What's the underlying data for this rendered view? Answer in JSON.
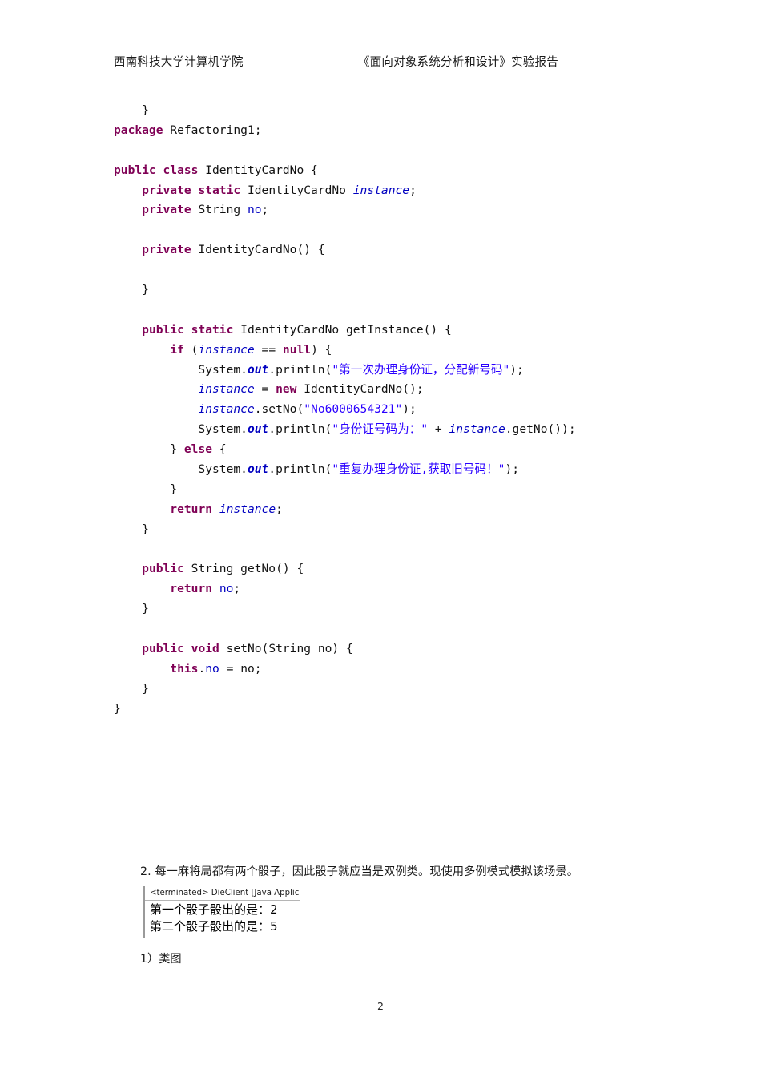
{
  "header": {
    "left": "西南科技大学计算机学院",
    "right": "《面向对象系统分析和设计》实验报告"
  },
  "code": {
    "language": "java",
    "lines": [
      [
        {
          "t": "    }",
          "c": "plain"
        }
      ],
      [
        {
          "t": "package",
          "c": "kw"
        },
        {
          "t": " Refactoring1;",
          "c": "plain"
        }
      ],
      [],
      [
        {
          "t": "public class",
          "c": "kw"
        },
        {
          "t": " IdentityCardNo {",
          "c": "plain"
        }
      ],
      [
        {
          "t": "    ",
          "c": "plain"
        },
        {
          "t": "private static",
          "c": "kw"
        },
        {
          "t": " IdentityCardNo ",
          "c": "plain"
        },
        {
          "t": "instance",
          "c": "fldi"
        },
        {
          "t": ";",
          "c": "plain"
        }
      ],
      [
        {
          "t": "    ",
          "c": "plain"
        },
        {
          "t": "private",
          "c": "kw"
        },
        {
          "t": " String ",
          "c": "plain"
        },
        {
          "t": "no",
          "c": "fld"
        },
        {
          "t": ";",
          "c": "plain"
        }
      ],
      [],
      [
        {
          "t": "    ",
          "c": "plain"
        },
        {
          "t": "private",
          "c": "kw"
        },
        {
          "t": " IdentityCardNo() {",
          "c": "plain"
        }
      ],
      [],
      [
        {
          "t": "    }",
          "c": "plain"
        }
      ],
      [],
      [
        {
          "t": "    ",
          "c": "plain"
        },
        {
          "t": "public static",
          "c": "kw"
        },
        {
          "t": " IdentityCardNo getInstance() {",
          "c": "plain"
        }
      ],
      [
        {
          "t": "        ",
          "c": "plain"
        },
        {
          "t": "if",
          "c": "kw"
        },
        {
          "t": " (",
          "c": "plain"
        },
        {
          "t": "instance",
          "c": "fldi"
        },
        {
          "t": " == ",
          "c": "plain"
        },
        {
          "t": "null",
          "c": "kw"
        },
        {
          "t": ") {",
          "c": "plain"
        }
      ],
      [
        {
          "t": "            System.",
          "c": "plain"
        },
        {
          "t": "out",
          "c": "stat"
        },
        {
          "t": ".println(",
          "c": "plain"
        },
        {
          "t": "\"第一次办理身份证，分配新号码\"",
          "c": "str"
        },
        {
          "t": ");",
          "c": "plain"
        }
      ],
      [
        {
          "t": "            ",
          "c": "plain"
        },
        {
          "t": "instance",
          "c": "fldi"
        },
        {
          "t": " = ",
          "c": "plain"
        },
        {
          "t": "new",
          "c": "kw"
        },
        {
          "t": " IdentityCardNo();",
          "c": "plain"
        }
      ],
      [
        {
          "t": "            ",
          "c": "plain"
        },
        {
          "t": "instance",
          "c": "fldi"
        },
        {
          "t": ".setNo(",
          "c": "plain"
        },
        {
          "t": "\"No6000654321\"",
          "c": "str"
        },
        {
          "t": ");",
          "c": "plain"
        }
      ],
      [
        {
          "t": "            System.",
          "c": "plain"
        },
        {
          "t": "out",
          "c": "stat"
        },
        {
          "t": ".println(",
          "c": "plain"
        },
        {
          "t": "\"身份证号码为：\"",
          "c": "str"
        },
        {
          "t": " + ",
          "c": "plain"
        },
        {
          "t": "instance",
          "c": "fldi"
        },
        {
          "t": ".getNo());",
          "c": "plain"
        }
      ],
      [
        {
          "t": "        } ",
          "c": "plain"
        },
        {
          "t": "else",
          "c": "kw"
        },
        {
          "t": " {",
          "c": "plain"
        }
      ],
      [
        {
          "t": "            System.",
          "c": "plain"
        },
        {
          "t": "out",
          "c": "stat"
        },
        {
          "t": ".println(",
          "c": "plain"
        },
        {
          "t": "\"重复办理身份证,获取旧号码！\"",
          "c": "str"
        },
        {
          "t": ");",
          "c": "plain"
        }
      ],
      [
        {
          "t": "        }",
          "c": "plain"
        }
      ],
      [
        {
          "t": "        ",
          "c": "plain"
        },
        {
          "t": "return",
          "c": "kw"
        },
        {
          "t": " ",
          "c": "plain"
        },
        {
          "t": "instance",
          "c": "fldi"
        },
        {
          "t": ";",
          "c": "plain"
        }
      ],
      [
        {
          "t": "    }",
          "c": "plain"
        }
      ],
      [],
      [
        {
          "t": "    ",
          "c": "plain"
        },
        {
          "t": "public",
          "c": "kw"
        },
        {
          "t": " String getNo() {",
          "c": "plain"
        }
      ],
      [
        {
          "t": "        ",
          "c": "plain"
        },
        {
          "t": "return",
          "c": "kw"
        },
        {
          "t": " ",
          "c": "plain"
        },
        {
          "t": "no",
          "c": "fld"
        },
        {
          "t": ";",
          "c": "plain"
        }
      ],
      [
        {
          "t": "    }",
          "c": "plain"
        }
      ],
      [],
      [
        {
          "t": "    ",
          "c": "plain"
        },
        {
          "t": "public void",
          "c": "kw"
        },
        {
          "t": " setNo(String ",
          "c": "plain"
        },
        {
          "t": "no",
          "c": "plain"
        },
        {
          "t": ") {",
          "c": "plain"
        }
      ],
      [
        {
          "t": "        ",
          "c": "plain"
        },
        {
          "t": "this",
          "c": "kw"
        },
        {
          "t": ".",
          "c": "plain"
        },
        {
          "t": "no",
          "c": "fld"
        },
        {
          "t": " = ",
          "c": "plain"
        },
        {
          "t": "no",
          "c": "plain"
        },
        {
          "t": ";",
          "c": "plain"
        }
      ],
      [
        {
          "t": "    }",
          "c": "plain"
        }
      ],
      [
        {
          "t": "}",
          "c": "plain"
        }
      ]
    ]
  },
  "body": {
    "question": "2. 每一麻将局都有两个骰子，因此骰子就应当是双例类。现使用多例模式模拟该场景。",
    "caption": "1）类图"
  },
  "console": {
    "title": "<terminated> DieClient [Java Applicatio",
    "lines": [
      "第一个骰子骰出的是：2",
      "第二个骰子骰出的是：5"
    ]
  },
  "footer": {
    "page_number": "2"
  },
  "colors": {
    "keyword": "#7f0055",
    "string": "#2a00ff",
    "field": "#0000c0",
    "static_field": "#0000c0",
    "text": "#111111",
    "page_background": "#ffffff"
  }
}
